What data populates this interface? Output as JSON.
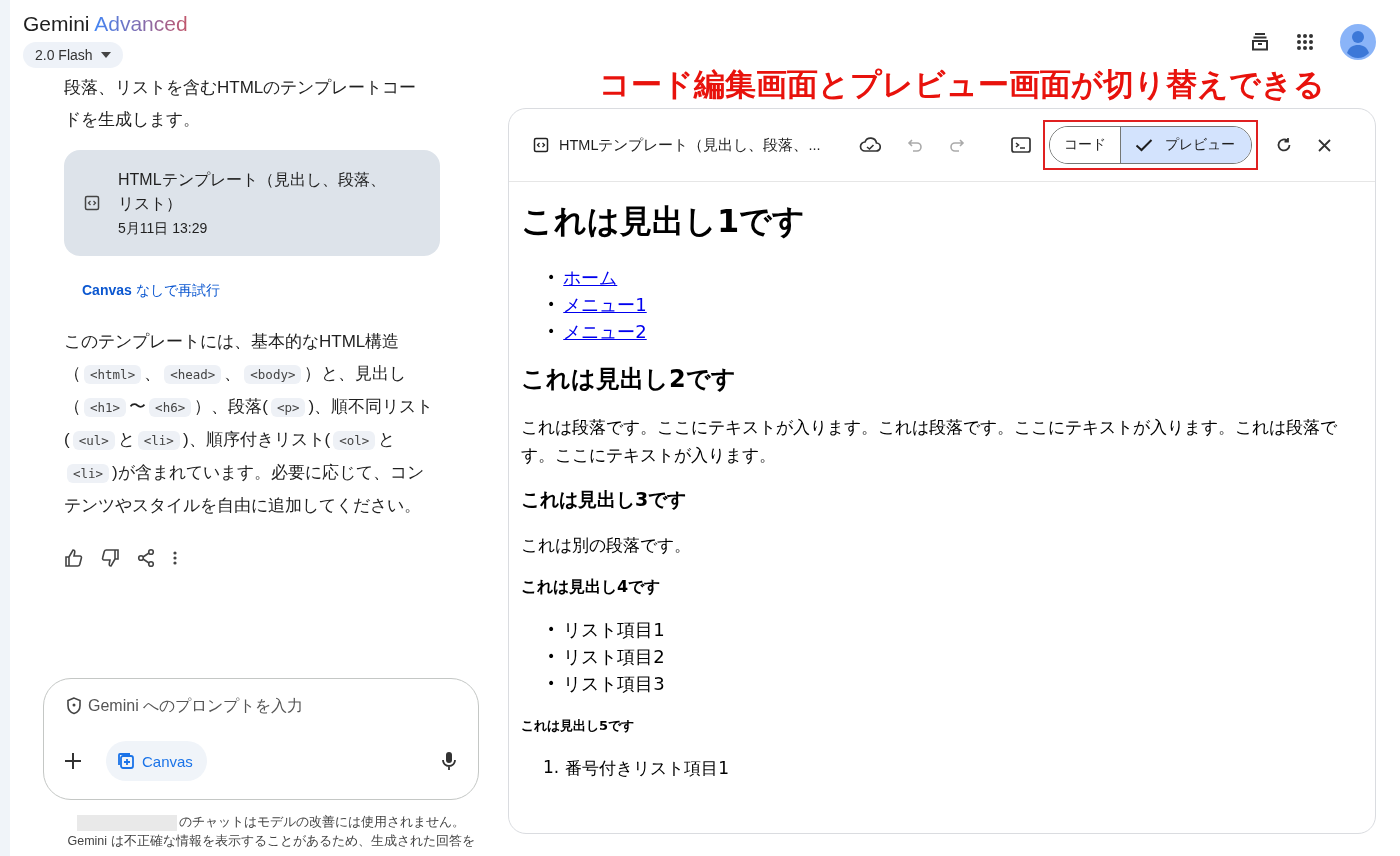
{
  "header": {
    "brand": "Gemini",
    "brand_tier": "Advanced",
    "model_picker": "2.0 Flash"
  },
  "chat": {
    "cut_lines": [
      "段落、リストを含むHTMLのテンプレートコー",
      "ドを生成します。"
    ],
    "artifact": {
      "title": "HTMLテンプレート（見出し、段落、リスト）",
      "date": "5月11日 13:29"
    },
    "retry_link": {
      "brand": "Canvas",
      "text": " なしで再試行"
    },
    "paragraph": [
      {
        "kind": "text",
        "text": "このテンプレートには、基本的なHTML構造（"
      },
      {
        "kind": "code",
        "text": "<html>"
      },
      {
        "kind": "text",
        "text": "、"
      },
      {
        "kind": "code",
        "text": "<head>"
      },
      {
        "kind": "text",
        "text": "、"
      },
      {
        "kind": "code",
        "text": "<body>"
      },
      {
        "kind": "text",
        "text": "）と、見出し（"
      },
      {
        "kind": "code",
        "text": "<h1>"
      },
      {
        "kind": "text",
        "text": "〜"
      },
      {
        "kind": "code",
        "text": "<h6>"
      },
      {
        "kind": "text",
        "text": "）、段落("
      },
      {
        "kind": "code",
        "text": "<p>"
      },
      {
        "kind": "text",
        "text": ")、順不同リスト("
      },
      {
        "kind": "code",
        "text": "<ul>"
      },
      {
        "kind": "text",
        "text": "と"
      },
      {
        "kind": "code",
        "text": "<li>"
      },
      {
        "kind": "text",
        "text": ")、順序付きリスト("
      },
      {
        "kind": "code",
        "text": "<ol>"
      },
      {
        "kind": "text",
        "text": "と"
      },
      {
        "kind": "code",
        "text": "<li>"
      },
      {
        "kind": "text",
        "text": ")が含まれています。必要に応じて、コンテンツやスタイルを自由に追加してください。"
      }
    ]
  },
  "prompt": {
    "placeholder": "Gemini へのプロンプトを入力",
    "canvas_chip": "Canvas"
  },
  "footer": {
    "line_1": "のチャットはモデルの改善には使用されません。",
    "line_2": "Gemini は不正確な情報を表示することがあるため、生成された回答を"
  },
  "annotation": "コード編集画面とプレビュー画面が切り替えできる",
  "canvas": {
    "title": "HTMLテンプレート（見出し、段落、...",
    "view_toggle": [
      {
        "label": "コード",
        "selected": false
      },
      {
        "label": "プレビュー",
        "selected": true
      }
    ],
    "preview": [
      {
        "kind": "h1",
        "text": "これは見出し1です"
      },
      {
        "kind": "ul",
        "items": [
          {
            "marker": "•",
            "text": "ホーム",
            "link": true
          },
          {
            "marker": "•",
            "text": "メニュー1",
            "link": true
          },
          {
            "marker": "•",
            "text": "メニュー2",
            "link": true
          }
        ]
      },
      {
        "kind": "h2",
        "text": "これは見出し2です"
      },
      {
        "kind": "p",
        "text": "これは段落です。ここにテキストが入ります。これは段落です。ここにテキストが入ります。これは段落です。ここにテキストが入ります。"
      },
      {
        "kind": "h3",
        "text": "これは見出し3です"
      },
      {
        "kind": "p",
        "text": "これは別の段落です。"
      },
      {
        "kind": "h4",
        "text": "これは見出し4です"
      },
      {
        "kind": "ul",
        "items": [
          {
            "marker": "•",
            "text": "リスト項目1",
            "link": false
          },
          {
            "marker": "•",
            "text": "リスト項目2",
            "link": false
          },
          {
            "marker": "•",
            "text": "リスト項目3",
            "link": false
          }
        ]
      },
      {
        "kind": "h5",
        "text": "これは見出し5です"
      },
      {
        "kind": "ol",
        "items": [
          {
            "marker": "1.",
            "text": "番号付きリスト項目1"
          }
        ]
      }
    ]
  }
}
